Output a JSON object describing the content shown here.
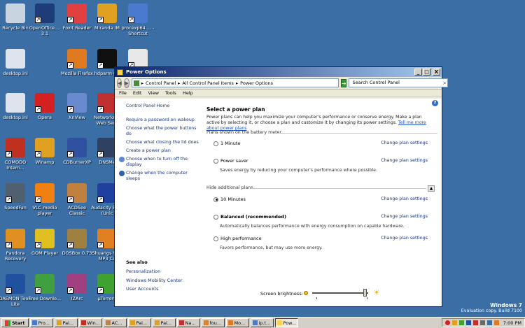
{
  "desktop_icons": [
    {
      "label": "Recycle Bin",
      "icon": "recycle-bin-icon",
      "color": "#c8d4e0"
    },
    {
      "label": "OpenOffice.... 3.1",
      "icon": "openoffice-icon",
      "color": "#1e3c78"
    },
    {
      "label": "Foxit Reader",
      "icon": "foxit-icon",
      "color": "#e04040"
    },
    {
      "label": "Miranda IM",
      "icon": "miranda-icon",
      "color": "#e0a020"
    },
    {
      "label": "procexp64.... - Shortcut",
      "icon": "process-explorer-icon",
      "color": "#4a7ad0"
    },
    {
      "label": "desktop.ini",
      "icon": "ini-file-icon",
      "color": "#dde4ee"
    },
    {
      "label": "Mozilla Firefox",
      "icon": "firefox-icon",
      "color": "#e07a20"
    },
    {
      "label": "hdparm (C:",
      "icon": "cmd-icon",
      "color": "#101010"
    },
    {
      "label": "",
      "icon": "file-icon",
      "color": "#e8e8e8"
    },
    {
      "label": "desktop.ini",
      "icon": "ini-file-icon",
      "color": "#dde4ee"
    },
    {
      "label": "Opera",
      "icon": "opera-icon",
      "color": "#d42020"
    },
    {
      "label": "XnView",
      "icon": "xnview-icon",
      "color": "#6a8ad0"
    },
    {
      "label": "NetworkA... Web Serv",
      "icon": "network-icon",
      "color": "#c03030"
    },
    {
      "label": "COMODO Intern...",
      "icon": "comodo-icon",
      "color": "#c03020"
    },
    {
      "label": "Winamp",
      "icon": "winamp-icon",
      "color": "#e0a020"
    },
    {
      "label": "CDBurnerXP",
      "icon": "cdburner-icon",
      "color": "#3050a0"
    },
    {
      "label": "DNSMe",
      "icon": "dns-icon",
      "color": "#304060"
    },
    {
      "label": "SpeedFan",
      "icon": "speedfan-icon",
      "color": "#506070"
    },
    {
      "label": "VLC media player",
      "icon": "vlc-icon",
      "color": "#f08010"
    },
    {
      "label": "ACDSee Classic",
      "icon": "acdsee-icon",
      "color": "#c08040"
    },
    {
      "label": "Audacity Beta (Unic",
      "icon": "audacity-icon",
      "color": "#2040a0"
    },
    {
      "label": "Pandora Recovery",
      "icon": "pandora-icon",
      "color": "#e09020"
    },
    {
      "label": "GOM Player",
      "icon": "gom-icon",
      "color": "#e0c020"
    },
    {
      "label": "DOSBox 0.73",
      "icon": "dosbox-icon",
      "color": "#a08040"
    },
    {
      "label": "Shuangs V to MP3 Co",
      "icon": "converter-icon",
      "color": "#e08020"
    },
    {
      "label": "DAEMON Tools Lite",
      "icon": "daemon-tools-icon",
      "color": "#2050a0"
    },
    {
      "label": "Free Downlo...",
      "icon": "free-download-icon",
      "color": "#40a040"
    },
    {
      "label": "IZArc",
      "icon": "izarc-icon",
      "color": "#a04080"
    },
    {
      "label": "µTorrent",
      "icon": "utorrent-icon",
      "color": "#40a030"
    }
  ],
  "window": {
    "title": "Power Options",
    "minimize": "_",
    "maximize": "□",
    "close": "X"
  },
  "address": {
    "path": [
      "Control Panel",
      "All Control Panel Items",
      "Power Options"
    ],
    "separator": "▸",
    "search_placeholder": "Search Control Panel"
  },
  "menu": [
    "File",
    "Edit",
    "View",
    "Tools",
    "Help"
  ],
  "left_pane": {
    "home": "Control Panel Home",
    "links": [
      "Require a password on wakeup",
      "Choose what the power buttons do",
      "Choose what closing the lid does",
      "Create a power plan",
      "Choose when to turn off the display",
      "Change when the computer sleeps"
    ],
    "see_also_heading": "See also",
    "see_also": [
      "Personalization",
      "Windows Mobility Center",
      "User Accounts"
    ]
  },
  "main": {
    "title": "Select a power plan",
    "description": "Power plans can help you maximize your computer's performance or conserve energy. Make a plan active by selecting it, or choose a plan and customize it by changing its power settings.",
    "more_link": "Tell me more about power plans",
    "battery_section": "Plans shown on the battery meter",
    "hidden_section": "Hide additional plans",
    "change_label": "Change plan settings",
    "plans": [
      {
        "name": "1 Minute",
        "bold": false,
        "selected": false,
        "desc": ""
      },
      {
        "name": "Power saver",
        "bold": false,
        "selected": false,
        "desc": "Saves energy by reducing your computer's performance where possible."
      },
      {
        "name": "10 Minutes",
        "bold": false,
        "selected": true,
        "desc": ""
      },
      {
        "name": "Balanced (recommended)",
        "bold": true,
        "selected": false,
        "desc": "Automatically balances performance with energy consumption on capable hardware."
      },
      {
        "name": "High performance",
        "bold": false,
        "selected": false,
        "desc": "Favors performance, but may use more energy."
      }
    ],
    "brightness_label": "Screen brightness:",
    "brightness_level": 0.95
  },
  "taskbar": {
    "start": "Start",
    "buttons": [
      {
        "label": "Pro...",
        "color": "#4a7ad0"
      },
      {
        "label": "Pai...",
        "color": "#e0a020"
      },
      {
        "label": "Win...",
        "color": "#c03020"
      },
      {
        "label": "AC...",
        "color": "#c08040"
      },
      {
        "label": "Pai...",
        "color": "#e0a020"
      },
      {
        "label": "Pai...",
        "color": "#e0a020"
      },
      {
        "label": "Na...",
        "color": "#c03030"
      },
      {
        "label": "fou...",
        "color": "#e08020"
      },
      {
        "label": "Mo...",
        "color": "#e07a20"
      },
      {
        "label": "ip.t...",
        "color": "#4a7ad0"
      },
      {
        "label": "Pow...",
        "color": "#ffd24a",
        "active": true
      }
    ],
    "clock": "7:00 PM"
  },
  "watermark": {
    "os": "Windows 7",
    "build": "Evaluation copy. Build 7100"
  }
}
